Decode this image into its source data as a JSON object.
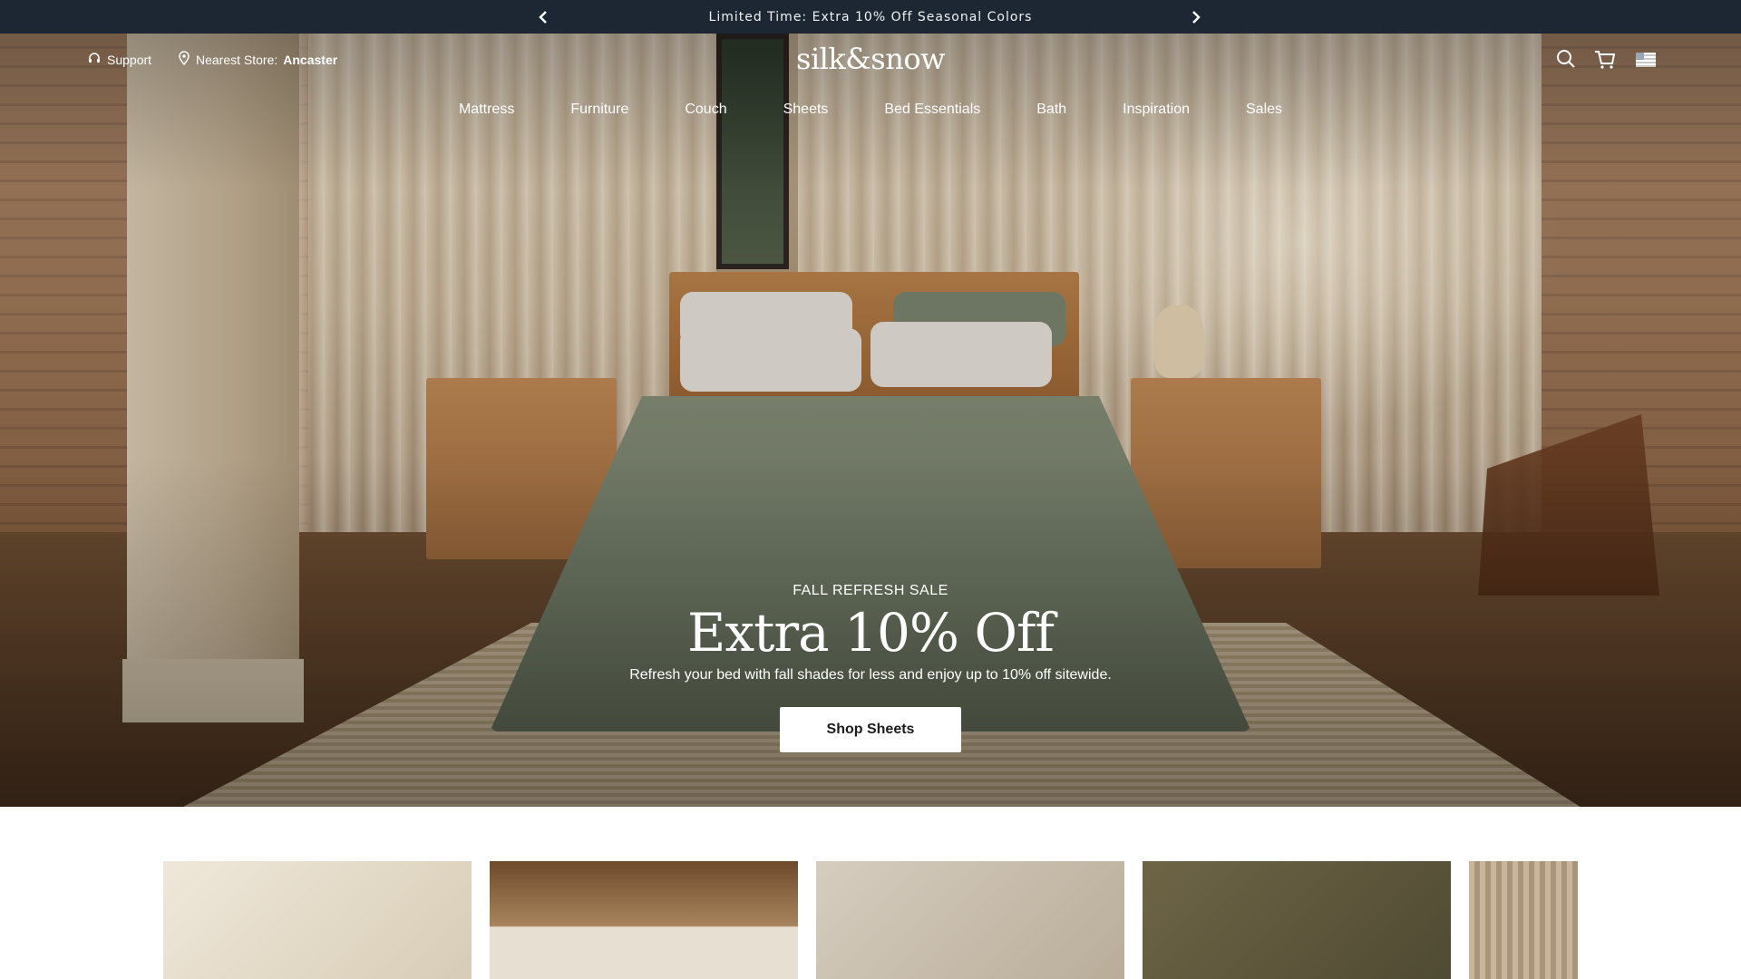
{
  "announcement": {
    "message": "Limited Time: Extra 10% Off Seasonal Colors"
  },
  "header": {
    "support_label": "Support",
    "store_label": "Nearest Store:",
    "store_name": "Ancaster",
    "logo": "silk&snow"
  },
  "nav": {
    "items": [
      {
        "label": "Mattress"
      },
      {
        "label": "Furniture"
      },
      {
        "label": "Couch"
      },
      {
        "label": "Sheets"
      },
      {
        "label": "Bed Essentials"
      },
      {
        "label": "Bath"
      },
      {
        "label": "Inspiration"
      },
      {
        "label": "Sales"
      }
    ]
  },
  "hero": {
    "eyebrow": "FALL REFRESH SALE",
    "headline": "Extra 10% Off",
    "subtext": "Refresh your bed with fall shades for less and enjoy up to 10% off sitewide.",
    "cta": "Shop Sheets"
  },
  "icons": [
    "chevron-left-icon",
    "chevron-right-icon",
    "headset-icon",
    "location-pin-icon",
    "search-icon",
    "cart-icon",
    "us-flag-icon"
  ],
  "colors": {
    "announcement_bg": "#1c2733",
    "text_light": "#ffffff",
    "cta_bg": "#ffffff"
  }
}
